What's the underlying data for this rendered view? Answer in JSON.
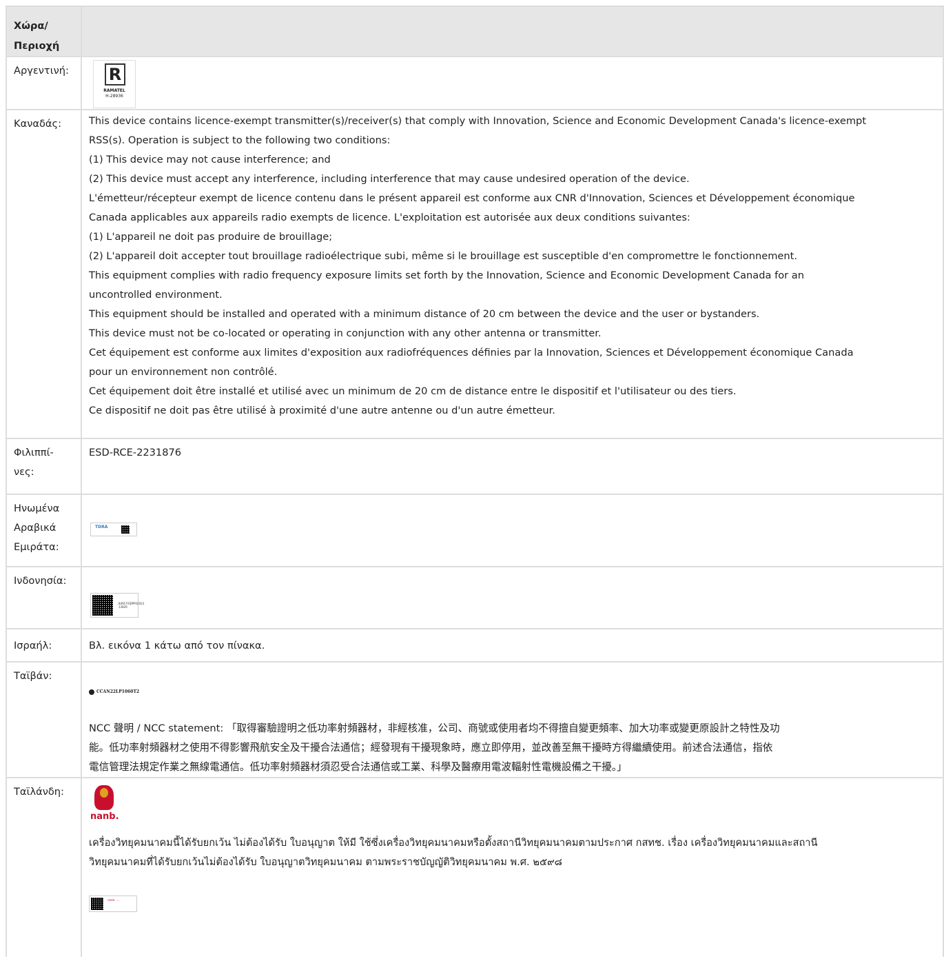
{
  "header": {
    "col1": "Χώρα/ Περιοχή"
  },
  "rows": {
    "argentina": {
      "country": "Αργεντινή:",
      "logo": {
        "mark": "R",
        "text1": "RAMATEL",
        "text2": "H-28936"
      }
    },
    "canada": {
      "country": "Καναδάς:",
      "lines": [
        "This device contains licence-exempt transmitter(s)/receiver(s) that comply with Innovation, Science and Economic Development Canada's licence-exempt",
        "RSS(s). Operation is subject to the following two conditions:",
        "(1) This device may not cause interference; and",
        "(2) This device must accept any interference, including interference that may cause undesired operation of the device.",
        "L'émetteur/récepteur exempt de licence contenu dans le présent appareil est conforme aux CNR d'Innovation, Sciences et Développement économique",
        "Canada applicables aux appareils radio exempts de licence. L'exploitation est autorisée aux deux conditions suivantes:",
        "(1) L'appareil ne doit pas produire de brouillage;",
        "(2) L'appareil doit accepter tout brouillage radioélectrique subi, même si le brouillage est susceptible d'en compromettre le fonctionnement.",
        "This equipment complies with radio frequency exposure limits set forth by the Innovation, Science and Economic Development Canada for an",
        "uncontrolled environment.",
        "This equipment should be installed and operated with a minimum distance of 20 cm between the device and the user or bystanders.",
        "This device must not be co-located or operating in conjunction with any other antenna or transmitter.",
        "Cet équipement est conforme aux limites d'exposition aux radiofréquences définies par la Innovation, Sciences et Développement économique Canada",
        "pour un environnement non contrôlé.",
        "Cet équipement doit être installé et utilisé avec un minimum de 20 cm de distance entre le dispositif et l'utilisateur ou des tiers.",
        "Ce dispositif ne doit pas être utilisé à proximité d'une autre antenne ou d'un autre émetteur."
      ]
    },
    "philippines": {
      "country_l1": "Φιλιππί-",
      "country_l2": "νες:",
      "text": "ESD-RCE-2231876"
    },
    "uae": {
      "country_l1": "Ηνωμένα",
      "country_l2": "Αραβικά",
      "country_l3": "Εμιράτα:",
      "logo_text": "TDRA"
    },
    "indonesia": {
      "country": "Ινδονησία:",
      "logo_text": "84917/SDPPI/2023 13829"
    },
    "israel": {
      "country": "Ισραήλ:",
      "text": "Βλ. εικόνα 1 κάτω από τον πίνακα."
    },
    "taiwan": {
      "country": "Ταϊβάν:",
      "ncc_id": "CCAN22LP1060T2",
      "lines": [
        "NCC 聲明 / NCC statement: 「取得審驗證明之低功率射頻器材，非經核准，公司、商號或使用者均不得擅自變更頻率、加大功率或變更原設計之特性及功",
        "能。低功率射頻器材之使用不得影響飛航安全及干擾合法通信；經發現有干擾現象時，應立即停用，並改善至無干擾時方得繼續使用。前述合法通信，指依",
        "電信管理法規定作業之無線電通信。低功率射頻器材須忍受合法通信或工業、科學及醫療用電波輻射性電機設備之干擾。」"
      ]
    },
    "thailand": {
      "country": "Ταϊλάνδη:",
      "logo_text": "nanb.",
      "lines": [
        "เครื่องวิทยุคมนาคมนี้ได้รับยกเว้น ไม่ต้องได้รับ ใบอนุญาต ให้มี ใช้ซึ่งเครื่องวิทยุคมนาคมหรือตั้งสถานีวิทยุคมนาคมตามประกาศ กสทช. เรื่อง เครื่องวิทยุคมนาคมและสถานี",
        "วิทยุคมนาคมที่ได้รับยกเว้นไม่ต้องได้รับ ใบอนุญาตวิทยุคมนาคม ตามพระราชบัญญัติวิทยุคมนาคม พ.ศ. ๒๕๙๘"
      ],
      "label_text": "nanb. ...."
    }
  }
}
